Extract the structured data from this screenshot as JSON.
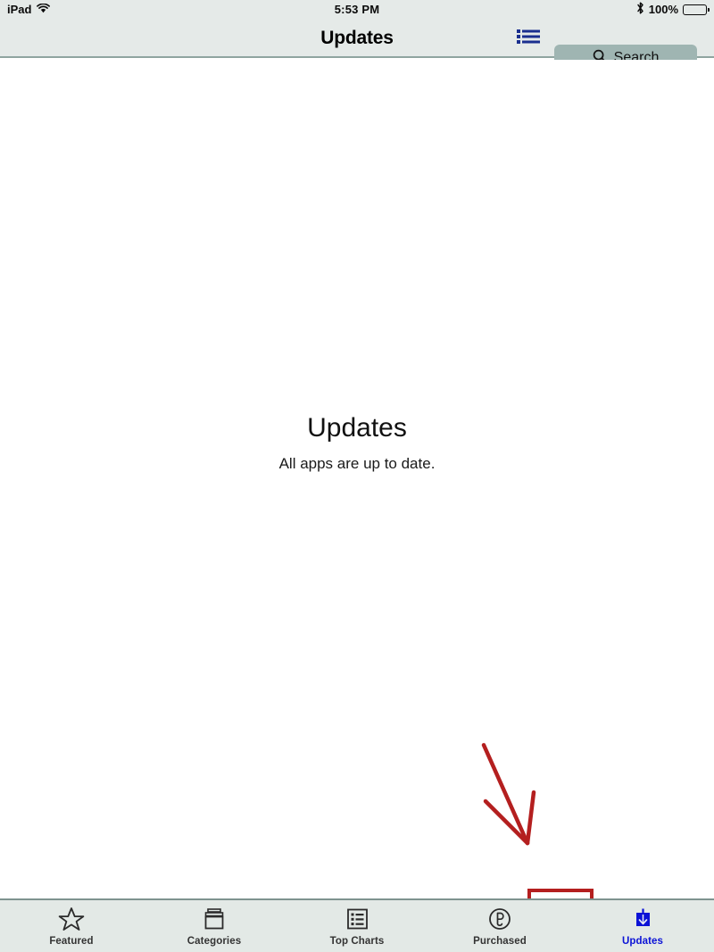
{
  "status_bar": {
    "device_label": "iPad",
    "wifi_icon": "wifi-icon",
    "time": "5:53 PM",
    "bluetooth_icon": "bluetooth-icon",
    "battery_percent": "100%",
    "battery_icon": "battery-full-icon"
  },
  "nav_bar": {
    "title": "Updates",
    "list_button_icon": "list-icon",
    "search": {
      "icon": "search-icon",
      "label": "Search",
      "placeholder": "Search"
    }
  },
  "content": {
    "empty_state": {
      "title": "Updates",
      "subtitle": "All apps are up to date."
    }
  },
  "annotations": {
    "arrow": "red-arrow-annotation",
    "highlight_box": "red-rectangle-annotation"
  },
  "tab_bar": {
    "items": [
      {
        "label": "Featured",
        "icon": "star-icon",
        "active": false
      },
      {
        "label": "Categories",
        "icon": "folders-icon",
        "active": false
      },
      {
        "label": "Top Charts",
        "icon": "chart-list-icon",
        "active": false
      },
      {
        "label": "Purchased",
        "icon": "purchased-circle-icon",
        "active": false
      },
      {
        "label": "Updates",
        "icon": "download-arrow-icon",
        "active": true
      }
    ]
  },
  "colors": {
    "bar_background": "#e5eae8",
    "tab_background": "#e3e9e6",
    "search_field": "#9fb5b2",
    "accent_blue": "#0b12d6",
    "annotation_red": "#b41f1f",
    "content_background": "#ffffff"
  }
}
